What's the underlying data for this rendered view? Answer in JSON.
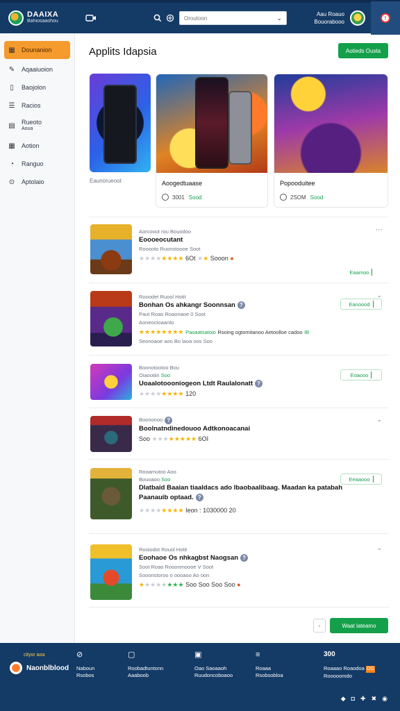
{
  "header": {
    "logo_line1": "DAAIXA",
    "logo_line2": "Bahiosaaohou",
    "video_icon": "video-camera-icon",
    "search_placeholder": "Oroutoon",
    "user_line1": "Aau Roauo",
    "user_line2": "Bouorabooo"
  },
  "sidebar": {
    "items": [
      {
        "label": "Dounanion",
        "icon": "calendar-icon",
        "active": true
      },
      {
        "label": "Aqaaiuoion",
        "icon": "edit-icon"
      },
      {
        "label": "Baojolon",
        "icon": "bookmark-icon"
      },
      {
        "label": "Racios",
        "icon": "list-icon"
      },
      {
        "label": "Rueoto",
        "label2": "Aoua",
        "icon": "calendar-grid-icon"
      },
      {
        "label": "Aotion",
        "icon": "grid-icon"
      },
      {
        "label": "Ranguo",
        "icon": "chat-icon"
      },
      {
        "label": "Aptolaio",
        "icon": "help-icon"
      }
    ]
  },
  "main": {
    "title": "Applits Idapsia",
    "top_button": "Aotieds Ousta"
  },
  "featured": {
    "card1_caption": "Eaunorueoot",
    "card2_title": "Aoogedtuaase",
    "card2_rating": "3001",
    "card2_status": "Sood",
    "card3_title": "Popooduitee",
    "card3_rating": "2SOM",
    "card3_status": "Sood"
  },
  "apps": [
    {
      "sub1": "Aorcooot rou Bouodoo",
      "name": "Eoooeocutant",
      "desc": "Rooooto Ruonstoooe Soot",
      "rating": "6Ot",
      "rating2": "Sooon",
      "button": "Eaamoo"
    },
    {
      "sub1": "Rooodet Ruool Hotit",
      "name": "Bonhan Os ahkangr Soonnsan",
      "desc1": "Paut Roao Roaonaoe 0 Soot",
      "desc2": "Aoneoctoaanto",
      "tag_green": "Paoaatsatoio",
      "tag_text": "Rsoing ogtomitanoo Aetoolloe cadoo",
      "tag_end": "IB",
      "desc3": "Seonoaoe aoo Bo laoa oos Soo",
      "button": "Eanoood"
    },
    {
      "sub1": "Boonotootoo Bou",
      "sub2": "Oiaootiin",
      "sub2_green": "Soo",
      "name": "Uoaalotoooniogeon Ltdt Raulalonatt",
      "rating": "120",
      "button": "Eoaooo"
    },
    {
      "sub1": "Boononoo",
      "name": "Boolnatndinedouoo Adtkonoacanai",
      "rating": "6OI",
      "rating_prefix": "Soo"
    },
    {
      "sub1": "Rooamutoo Aoo",
      "sub2": "Bouoaoo",
      "sub2_green": "Soo",
      "name": "Dlatbaid Baaian tiaaldacs ado Ibaobaalibaag. Maadan ka patabah",
      "name2": "Paanauib optaad.",
      "rating": "Ieon : 1030000 20",
      "button": "Eeaaooo"
    },
    {
      "sub1": "Rooiodot Rouol Hotit",
      "name": "Eoohaoe Os nhkagbst Naogsan",
      "desc": "Soot Roao Rooonmoooe V Soot",
      "desc2": "Sooonstoroo o oooaoo Ao oon",
      "rating": "Soo Soo Soo Soo"
    }
  ],
  "pager": {
    "back": "◦",
    "next_button": "Waat lateamo"
  },
  "footer": {
    "tag": "cityor aoa",
    "brand": "Naonblblood",
    "cols": [
      {
        "icon": "search-icon",
        "l1": "Naboun",
        "l2": "Rsobos"
      },
      {
        "icon": "picture-icon",
        "l1": "Roobadtuntonn",
        "l2": "Aaaboob"
      },
      {
        "icon": "image-icon",
        "l1": "Oao Saoaaoh",
        "l2": "Ruudoncoboaoo"
      },
      {
        "icon": "menu-icon",
        "l1": "Roaaa",
        "l2": "Rsobsobloa"
      },
      {
        "num": "300",
        "l1": "Roaaao Roaodoa",
        "l2": "Rooooomdo"
      }
    ],
    "badge": "OG",
    "socials": [
      "◆",
      "◘",
      "✚",
      "✖",
      "◉"
    ]
  },
  "colors": {
    "header_bg": "#143a66",
    "accent_orange": "#f59a2d",
    "accent_green": "#14a04a",
    "star": "#f5b300"
  }
}
